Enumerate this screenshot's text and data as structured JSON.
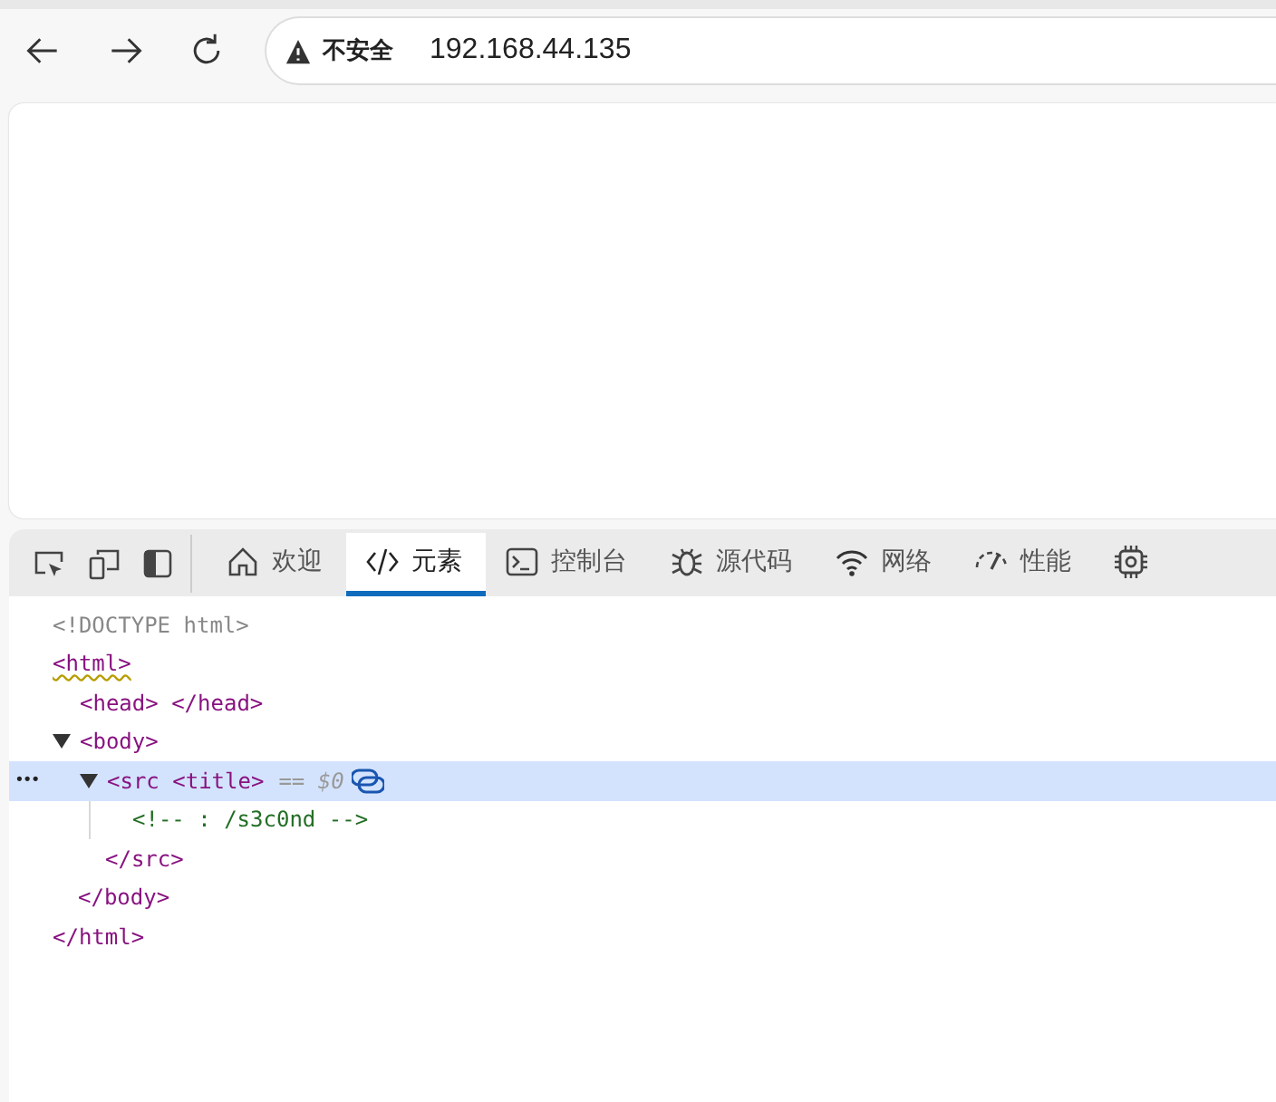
{
  "address_bar": {
    "security_label": "不安全",
    "url": "192.168.44.135"
  },
  "devtools": {
    "tabs": [
      {
        "label": "欢迎",
        "kind": "home",
        "selected": false
      },
      {
        "label": "元素",
        "kind": "code",
        "selected": true
      },
      {
        "label": "控制台",
        "kind": "console",
        "selected": false
      },
      {
        "label": "源代码",
        "kind": "bug",
        "selected": false
      },
      {
        "label": "网络",
        "kind": "wifi",
        "selected": false
      },
      {
        "label": "性能",
        "kind": "gauge",
        "selected": false
      },
      {
        "kind": "chip",
        "selected": false
      }
    ],
    "dom_tree": [
      {
        "kind": "doctype",
        "text": "<!DOCTYPE html>"
      },
      {
        "kind": "element",
        "open": "<html>",
        "close": "</html>",
        "warning": true,
        "selected": false,
        "children": [
          {
            "kind": "element",
            "open": "<head> </head>",
            "warning": false,
            "selected": false
          },
          {
            "kind": "element",
            "open": "<body>",
            "close": "</body>",
            "warning": false,
            "expanded": true,
            "selected": false,
            "children": [
              {
                "kind": "element",
                "open": "<src <title>",
                "close": "</src>",
                "ref": "== $0",
                "more": "•••",
                "warning": false,
                "expanded": true,
                "selected": true,
                "children": [
                  {
                    "kind": "comment",
                    "text": "<!-- : /s3c0nd -->"
                  }
                ]
              }
            ]
          }
        ]
      }
    ]
  }
}
